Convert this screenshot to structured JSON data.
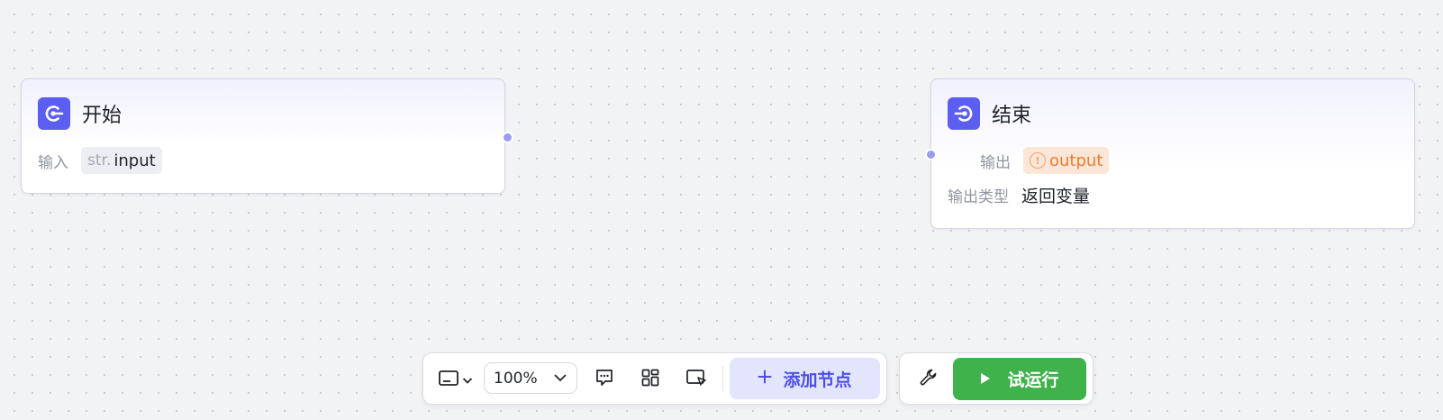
{
  "nodes": {
    "start": {
      "title": "开始",
      "input_label": "输入",
      "input_type": "str.",
      "input_name": "input"
    },
    "end": {
      "title": "结束",
      "output_label": "输出",
      "output_name": "output",
      "output_type_label": "输出类型",
      "output_type_value": "返回变量"
    }
  },
  "toolbar": {
    "zoom_value": "100%",
    "add_node_label": "添加节点",
    "run_label": "试运行",
    "icons": [
      "minimap-icon",
      "chevron-down-icon",
      "comment-icon",
      "layout-grid-icon",
      "select-pointer-icon",
      "plus-icon",
      "wrench-icon",
      "play-icon"
    ]
  },
  "colors": {
    "accent": "#5b5ef0",
    "run_green": "#3fb24b",
    "warning_orange": "#f07a2c",
    "port": "#9a9cf0"
  }
}
